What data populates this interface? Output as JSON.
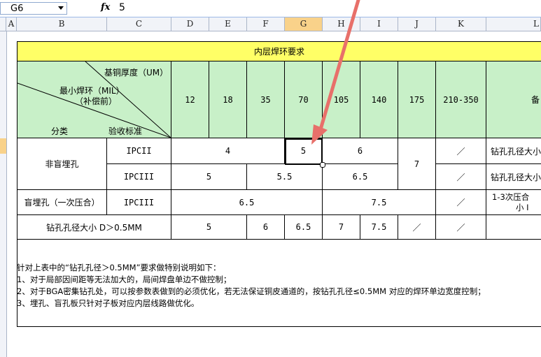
{
  "formula_bar": {
    "name_box": "G6",
    "fx_label": "fx",
    "value": "5"
  },
  "columns": [
    "A",
    "B",
    "C",
    "D",
    "E",
    "F",
    "G",
    "H",
    "I",
    "J",
    "K",
    "L"
  ],
  "table": {
    "title": "内层焊环要求",
    "diag_top": "基铜厚度（UM）",
    "diag_mid1": "最小焊环（MIL）",
    "diag_mid2": "（补偿前）",
    "diag_bot_left": "分类",
    "diag_bot_right": "验收标准",
    "thickness": [
      "12",
      "18",
      "35",
      "70",
      "105",
      "140",
      "175",
      "210-350"
    ],
    "last_header": "备",
    "row1_cat": "非盲埋孔",
    "row1_std_a": "IPCII",
    "row1_std_b": "IPCIII",
    "r1a_v1": "4",
    "r1a_v2": "5",
    "r1a_v3": "6",
    "r1_j": "7",
    "slash": "／",
    "r1a_note": "钻孔孔径大小",
    "r1b_v1": "5",
    "r1b_v2": "5.5",
    "r1b_v3": "6.5",
    "r1b_note": "钻孔孔径大小",
    "row2_cat": "盲埋孔（一次压合）",
    "row2_std": "IPCIII",
    "r2_v1": "6.5",
    "r2_v2": "7.5",
    "r2_note1": "1-3次压合",
    "r2_note2": "小    I",
    "row3_cat": "钻孔孔径大小    D＞0.5MM",
    "r3_vals": [
      "5",
      "6",
      "6.5",
      "7",
      "7.5"
    ],
    "notes": [
      "针对上表中的“钻孔孔径＞0.5MM”要求做特别说明如下：",
      "1、对于局部因间距等无法加大的，局间焊盘单边不做控制；",
      "2、对于BGA密集钻孔处，可以按参数表做到的必须优化，若无法保证铜皮通道的，按钻孔孔径≤0.5MM 对应的焊环单边宽度控制；",
      "3、埋孔、盲孔板只针对子板对应内层线路做优化。"
    ]
  },
  "colors": {
    "title_bg": "#ffff66",
    "header_bg": "#c8f0c8",
    "arrow": "#e8706a",
    "selected_header": "#f9d28a"
  }
}
